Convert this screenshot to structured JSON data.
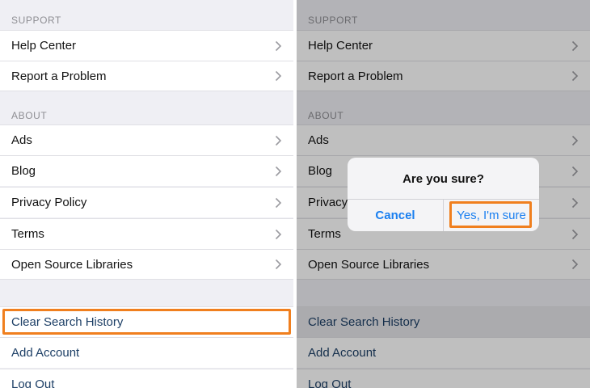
{
  "sections": {
    "support": "SUPPORT",
    "about": "ABOUT"
  },
  "support_items": [
    "Help Center",
    "Report a Problem"
  ],
  "about_items": [
    "Ads",
    "Blog",
    "Privacy Policy",
    "Terms",
    "Open Source Libraries"
  ],
  "right_about_items": [
    "Ads",
    "Blog",
    "Privacy",
    "Terms",
    "Open Source Libraries"
  ],
  "actions": [
    "Clear Search History",
    "Add Account",
    "Log Out"
  ],
  "alert": {
    "title": "Are you sure?",
    "cancel_label": "Cancel",
    "confirm_label": "Yes, I'm sure"
  },
  "colors": {
    "highlight": "#f07f1e",
    "action_text": "#1d3f66",
    "alert_button": "#1a7ff0"
  },
  "icons": {
    "chevron": "chevron-right-icon"
  }
}
